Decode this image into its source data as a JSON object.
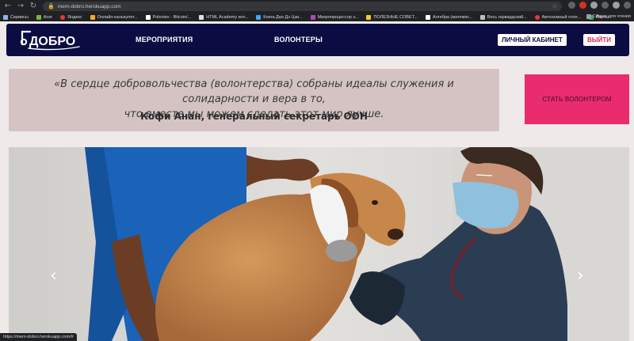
{
  "browser": {
    "url": "mem-dobro.herokuapp.com",
    "bookmarks": [
      "Сервисы",
      "Acer",
      "Яндекс",
      "Онлайн-калькулят...",
      "Poloniex - Bitcoin/...",
      "HTML Academy инт...",
      "Книга Дао Дэ Цзи...",
      "Микропроцессор з...",
      "ПОЛЕЗНЫЕ СОВЕТ...",
      "Алгебра (математ...",
      "Весь гарвардский...",
      "Автономный отоп...",
      "Карты"
    ],
    "bookmarks_more": "»",
    "reading_list": "Список для чтения",
    "status_url": "https://mem-dobro.herokuapp.com/#"
  },
  "header": {
    "logo_text": "ДОБРО",
    "nav": {
      "events": "МЕРОПРИЯТИЯ",
      "volunteers": "ВОЛОНТЕРЫ"
    },
    "cabinet_label": "ЛИЧНЫЙ КАБИНЕТ",
    "logout_label": "ВЫЙТИ"
  },
  "quote": {
    "line1": "«В сердце добровольчества (волонтерства) собраны идеалы служения и солидарности и вера в то,",
    "line2": "что вместе мы можем сделать этот мир лучше.",
    "author": "Кофи Анан, генеральный секретарь ООН"
  },
  "cta": {
    "become_volunteer": "СТАТЬ ВОЛОНТЕРОМ"
  },
  "carousel": {
    "prev": "‹",
    "next": "›"
  },
  "colors": {
    "header_bg": "#0b0c42",
    "accent": "#ea2b6e",
    "quote_bg": "#d5c3c3",
    "page_bg": "#efe9e9"
  }
}
